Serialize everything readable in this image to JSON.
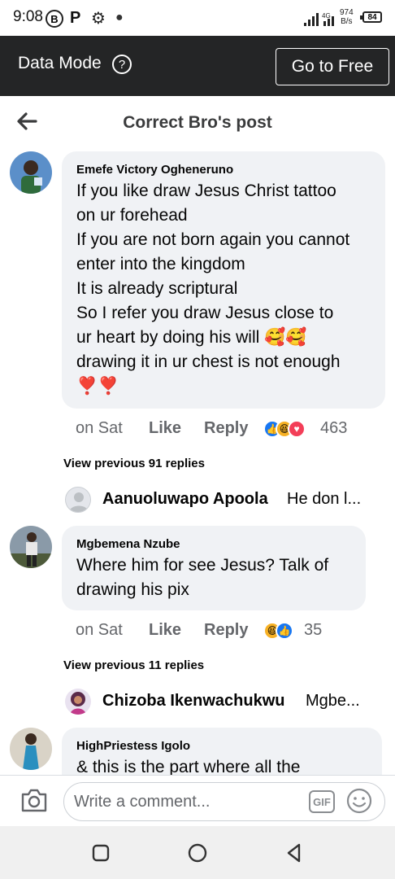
{
  "status_bar": {
    "time": "9:08",
    "icons": [
      "b-circle-icon",
      "p-icon",
      "gear-icon",
      "dot-icon"
    ],
    "network_speed_value": "974",
    "network_speed_unit": "B/s",
    "network_type": "4G",
    "battery": "84"
  },
  "data_bar": {
    "label": "Data Mode",
    "help_glyph": "?",
    "cta": "Go to Free"
  },
  "header": {
    "title": "Correct Bro's post"
  },
  "comments": [
    {
      "author": "Emefe Victory Ogheneruno",
      "text": "If you like draw Jesus Christ tattoo\non ur forehead\nIf you are not born again you cannot\nenter into the kingdom\n It is already scriptural\nSo I refer you draw Jesus close to\nur heart by doing his will 🥰🥰\ndrawing it in ur chest is not enough\n❣️❣️",
      "time": "on Sat",
      "like": "Like",
      "reply": "Reply",
      "reactions": [
        "like-reaction-icon",
        "haha-reaction-icon",
        "love-reaction-icon"
      ],
      "reaction_count": "463",
      "view_previous": "View previous 91 replies",
      "latest_reply": {
        "name": "Aanuoluwapo Apoola",
        "snippet": "He don l..."
      }
    },
    {
      "author": "Mgbemena Nzube",
      "text": "Where him for see Jesus? Talk of\ndrawing his pix",
      "time": "on Sat",
      "like": "Like",
      "reply": "Reply",
      "reactions": [
        "haha-reaction-icon",
        "like-reaction-icon"
      ],
      "reaction_count": "35",
      "view_previous": "View previous 11 replies",
      "latest_reply": {
        "name": "Chizoba Ikenwachukwu",
        "snippet": "Mgbe..."
      }
    },
    {
      "author": "HighPriestess Igolo",
      "text": "& this is the part where all the"
    }
  ],
  "composer": {
    "placeholder": "Write a comment...",
    "gif_label": "GIF"
  },
  "colors": {
    "data_bar_bg": "#242526",
    "bubble_bg": "#f0f2f5",
    "meta_gray": "#65676b",
    "like_blue": "#1877f2"
  }
}
